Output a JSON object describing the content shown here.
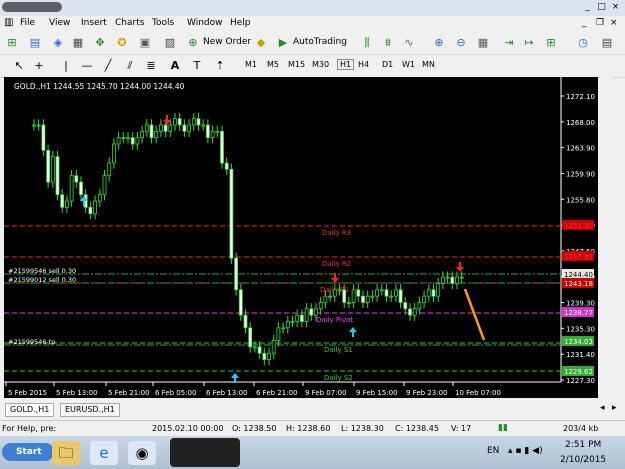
{
  "window": {
    "minimize": "_",
    "maximize": "□",
    "close": "×"
  },
  "menu": [
    "File",
    "View",
    "Insert",
    "Charts",
    "Tools",
    "Window",
    "Help"
  ],
  "toolbar": {
    "new_order": "New Order",
    "autotrading": "AutoTrading"
  },
  "timeframes": [
    "M1",
    "M5",
    "M15",
    "M30",
    "H1",
    "H4",
    "D1",
    "W1",
    "MN"
  ],
  "chart": {
    "header": "GOLD.,H1  1244.55 1245.70 1244.00 1244.40",
    "price_axis": [
      "1272.10",
      "1268.00",
      "1263.90",
      "1259.90",
      "1255.80",
      "1251.70",
      "1247.60",
      "1243.40",
      "1239.30",
      "1235.30",
      "1231.40",
      "1227.30"
    ],
    "price_tags": [
      {
        "text": "1251.30",
        "color": "#cc0000",
        "text_color": "#ff3030"
      },
      {
        "text": "1247.82",
        "color": "#cc0000",
        "text_color": "#ff3030"
      },
      {
        "text": "1244.40",
        "color": "#e8e8e8",
        "text_color": "#000000"
      },
      {
        "text": "1243.18",
        "color": "#cc0000",
        "text_color": "#ffffff"
      },
      {
        "text": "1238.77",
        "color": "#cc33cc",
        "text_color": "#ffffff"
      },
      {
        "text": "1234.03",
        "color": "#33aa33",
        "text_color": "#ffffff"
      },
      {
        "text": "1229.62",
        "color": "#33aa33",
        "text_color": "#ffffff"
      }
    ],
    "time_axis": [
      "5 Feb 2015",
      "5 Feb 13:00",
      "5 Feb 21:00",
      "6 Feb 05:00",
      "6 Feb 13:00",
      "6 Feb 21:00",
      "9 Feb 07:00",
      "9 Feb 15:00",
      "9 Feb 23:00",
      "10 Feb 07:00"
    ],
    "levels": [
      {
        "label": "Daily R3",
        "color": "#ff2020"
      },
      {
        "label": "Daily R2",
        "color": "#ff2020"
      },
      {
        "label": "Daily R1",
        "color": "#ff2020"
      },
      {
        "label": "Daily Pivot",
        "color": "#ff33ff"
      },
      {
        "label": "Daily S1",
        "color": "#33cc33"
      },
      {
        "label": "Daily S2",
        "color": "#33cc33"
      }
    ],
    "orders": [
      {
        "label": "#21599546 sell 0.30"
      },
      {
        "label": "#21599012 sell 0.30"
      },
      {
        "label": "#21599546 tp"
      }
    ]
  },
  "tabs": [
    "GOLD.,H1",
    "EURUSD.,H1"
  ],
  "status": {
    "help": "For Help, pre:",
    "datetime": "2015.02.10 00:00",
    "open": "O: 1238.50",
    "high": "H: 1238.60",
    "low": "L: 1238.30",
    "close": "C: 1238.45",
    "volume": "V: 17",
    "traffic": "203/4 kb"
  },
  "taskbar": {
    "start": "Start",
    "lang": "EN",
    "time": "2:51 PM",
    "date": "2/10/2015"
  }
}
